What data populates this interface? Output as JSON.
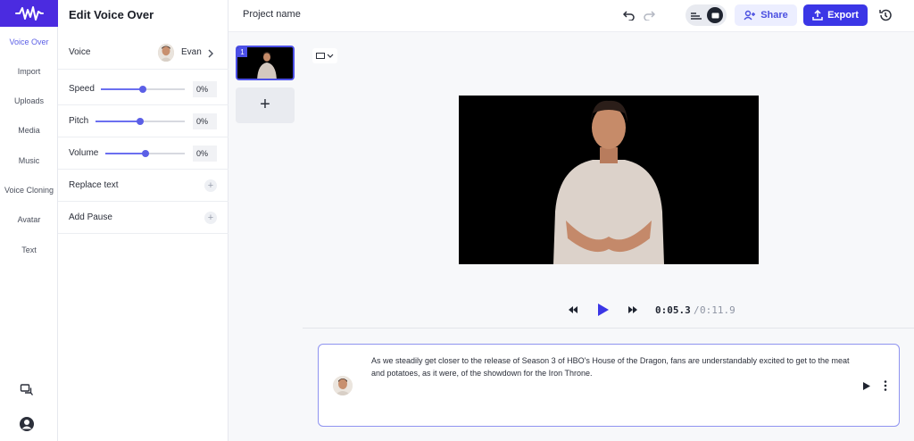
{
  "sidebar": {
    "items": [
      {
        "label": "Voice Over",
        "active": true
      },
      {
        "label": "Import"
      },
      {
        "label": "Uploads"
      },
      {
        "label": "Media"
      },
      {
        "label": "Music"
      },
      {
        "label": "Voice Cloning"
      },
      {
        "label": "Avatar"
      },
      {
        "label": "Text"
      }
    ],
    "bottom_icons": [
      "chat-icon",
      "user-profile-icon"
    ]
  },
  "panel": {
    "title": "Edit Voice Over",
    "voice_label": "Voice",
    "voice_name": "Evan",
    "speed_label": "Speed",
    "speed_value": "0%",
    "speed_level": 0.5,
    "pitch_label": "Pitch",
    "pitch_value": "0%",
    "pitch_level": 0.5,
    "volume_label": "Volume",
    "volume_value": "0%",
    "volume_level": 0.5,
    "replace_text_label": "Replace text",
    "add_pause_label": "Add Pause"
  },
  "topbar": {
    "project_name": "Project name",
    "share_label": "Share",
    "export_label": "Export"
  },
  "scenes": {
    "items": [
      {
        "number": "1"
      }
    ],
    "add_label": "+"
  },
  "player": {
    "current_time": "0:05.3",
    "separator": "/",
    "total_time": "0:11.9"
  },
  "script": {
    "text": "As we steadily get closer to the release of Season 3 of HBO's House of the Dragon, fans are understandably excited to get to the meat and potatoes, as it were, of the showdown for the Iron Throne."
  },
  "colors": {
    "brand": "#4b2be0",
    "accent": "#5b5fe6",
    "export": "#3b36e6"
  }
}
